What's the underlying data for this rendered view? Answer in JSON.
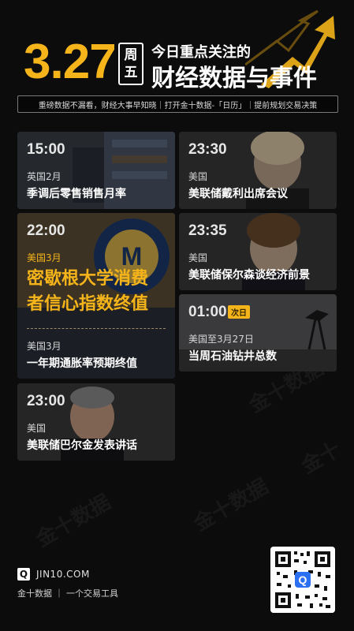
{
  "header": {
    "date": "3.27",
    "weekday_line1": "周",
    "weekday_line2": "五",
    "title_top": "今日重点关注的",
    "title_main": "财经数据与事件",
    "subtitle": "重磅数据不漏看，财经大事早知晓｜打开金十数据-「日历」｜提前规划交易决策"
  },
  "cards": [
    {
      "time": "15:00",
      "country": "英国2月",
      "event": "季调后零售销售月率"
    },
    {
      "time": "23:30",
      "country": "美国",
      "event": "美联储戴利出席会议"
    },
    {
      "time": "22:00",
      "country": "美国3月",
      "event_line1": "密歇根大学消费",
      "event_line2": "者信心指数终值",
      "country2": "美国3月",
      "event2": "一年期通胀率预期终值"
    },
    {
      "time": "23:35",
      "country": "美国",
      "event": "美联储保尔森谈经济前景"
    },
    {
      "time": "01:00",
      "badge": "次日",
      "country": "美国至3月27日",
      "event": "当周石油钻井总数"
    },
    {
      "time": "23:00",
      "country": "美国",
      "event": "美联储巴尔金发表讲话"
    }
  ],
  "footer": {
    "logo_letter": "Q",
    "domain": "JIN10.COM",
    "slogan": "金十数据 ｜ 一个交易工具"
  },
  "colors": {
    "accent": "#f4b41a",
    "card_bg": "#2e2e2e",
    "page_bg": "#0c0c0c"
  },
  "icons": [
    "arrow-up-icon",
    "logo-q-icon",
    "qr-code"
  ]
}
